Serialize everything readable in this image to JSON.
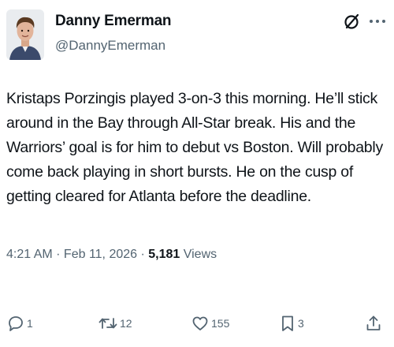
{
  "author": {
    "name": "Danny Emerman",
    "handle": "@DannyEmerman"
  },
  "header_icons": [
    "grok-icon",
    "more-icon"
  ],
  "tweet": {
    "text": "Kristaps Porzingis played 3-on-3 this morning. He’ll stick around in the Bay through All-Star break. His and the Warriors’ goal is for him to debut vs Boston. Will probably come back playing in short bursts. He on the cusp of getting cleared for Atlanta before the deadline."
  },
  "meta": {
    "time": "4:21 AM",
    "separator1": " · ",
    "date": "Feb 11, 2026",
    "separator2": " · ",
    "views_count": "5,181",
    "views_label": " Views"
  },
  "actions": {
    "replies": "1",
    "reposts": "12",
    "likes": "155",
    "bookmarks": "3"
  },
  "colors": {
    "text": "#0f1419",
    "secondary": "#536471"
  }
}
